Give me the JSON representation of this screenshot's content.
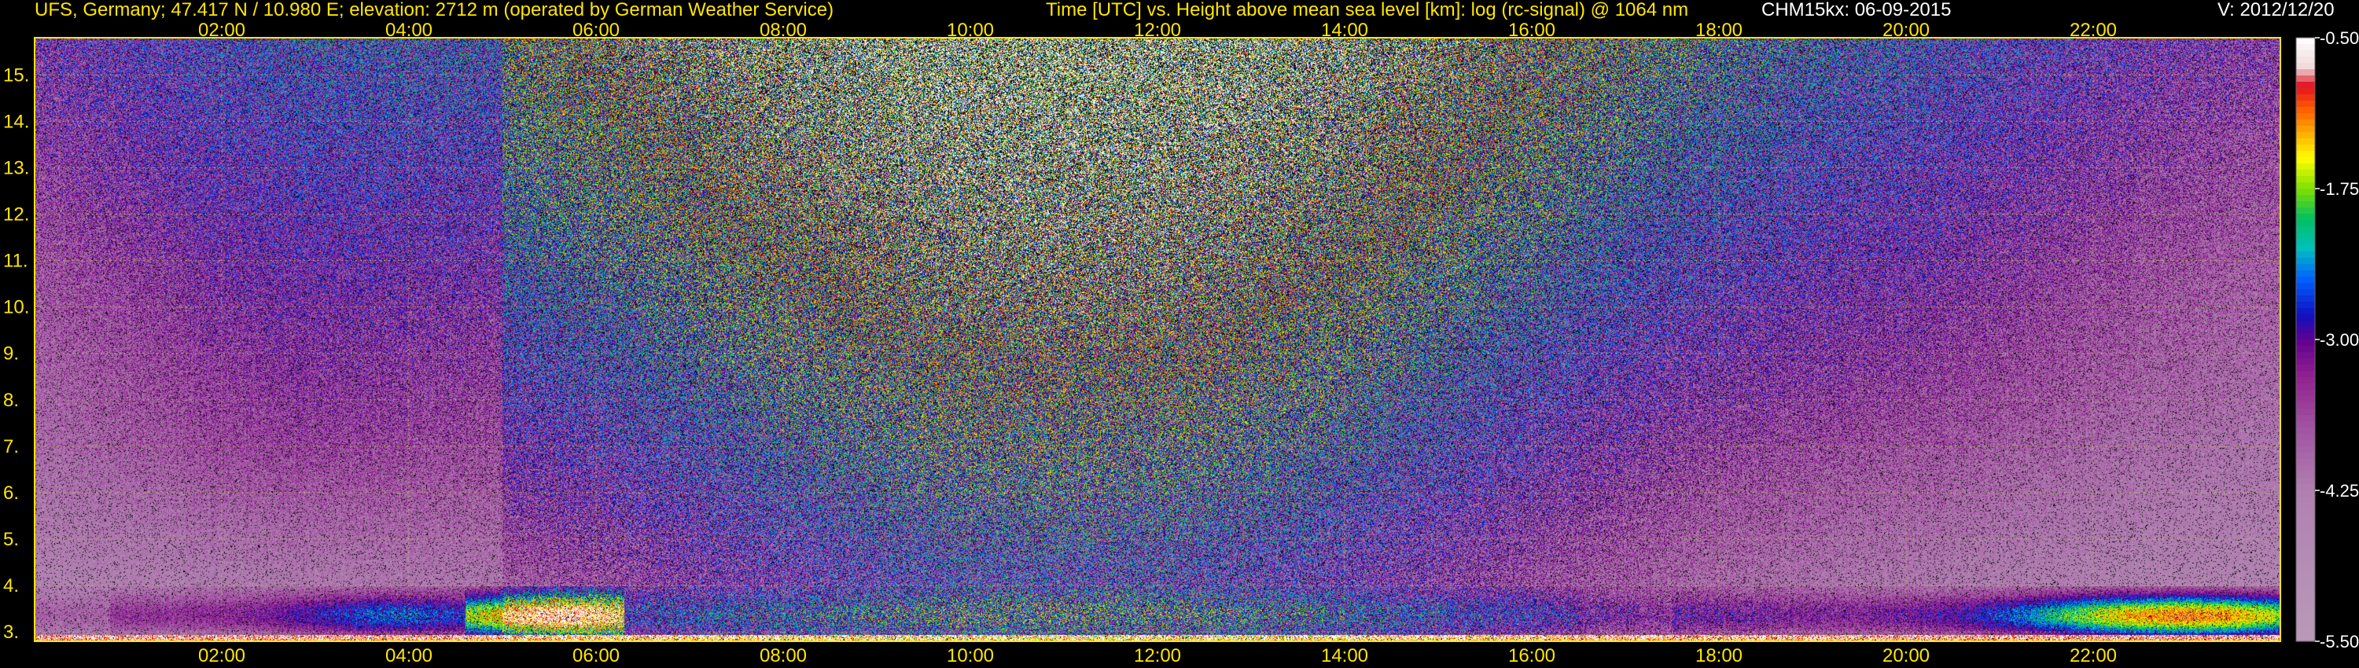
{
  "header": {
    "station": "UFS, Germany; 47.417 N / 10.980 E; elevation: 2712 m  (operated by German Weather Service)",
    "description": "Time [UTC] vs. Height above mean sea level [km]: log (rc-signal) @ 1064 nm",
    "instrument": "CHM15kx: 06-09-2015",
    "version": "V: 2012/12/20"
  },
  "chart_data": {
    "type": "heatmap",
    "x_ticks": [
      "02:00",
      "04:00",
      "06:00",
      "08:00",
      "10:00",
      "12:00",
      "14:00",
      "16:00",
      "18:00",
      "20:00",
      "22:00"
    ],
    "x_range_hours": [
      0,
      24
    ],
    "y_ticks": [
      "3.",
      "4.",
      "5.",
      "6.",
      "7.",
      "8.",
      "9.",
      "10.",
      "11.",
      "12.",
      "13.",
      "14.",
      "15."
    ],
    "y_range_km": [
      2.8,
      15.8
    ],
    "grid": true,
    "colorbar": {
      "labels": [
        "-0.50",
        "-1.75",
        "-3.00",
        "-4.25",
        "-5.50"
      ],
      "range": [
        -5.5,
        -0.5
      ],
      "stops": [
        {
          "v": -0.5,
          "c": "#ffffff"
        },
        {
          "v": -0.75,
          "c": "#f0dada"
        },
        {
          "v": -0.9,
          "c": "#e01020"
        },
        {
          "v": -1.1,
          "c": "#ff6000"
        },
        {
          "v": -1.3,
          "c": "#ffb000"
        },
        {
          "v": -1.5,
          "c": "#ffff00"
        },
        {
          "v": -1.75,
          "c": "#80e000"
        },
        {
          "v": -2.0,
          "c": "#00c060"
        },
        {
          "v": -2.25,
          "c": "#00c0c0"
        },
        {
          "v": -2.5,
          "c": "#0060ff"
        },
        {
          "v": -2.8,
          "c": "#1010c0"
        },
        {
          "v": -3.0,
          "c": "#600090"
        },
        {
          "v": -3.3,
          "c": "#902090"
        },
        {
          "v": -3.7,
          "c": "#a050a0"
        },
        {
          "v": -4.25,
          "c": "#b080b0"
        },
        {
          "v": -5.5,
          "c": "#b89ab8"
        }
      ]
    }
  }
}
